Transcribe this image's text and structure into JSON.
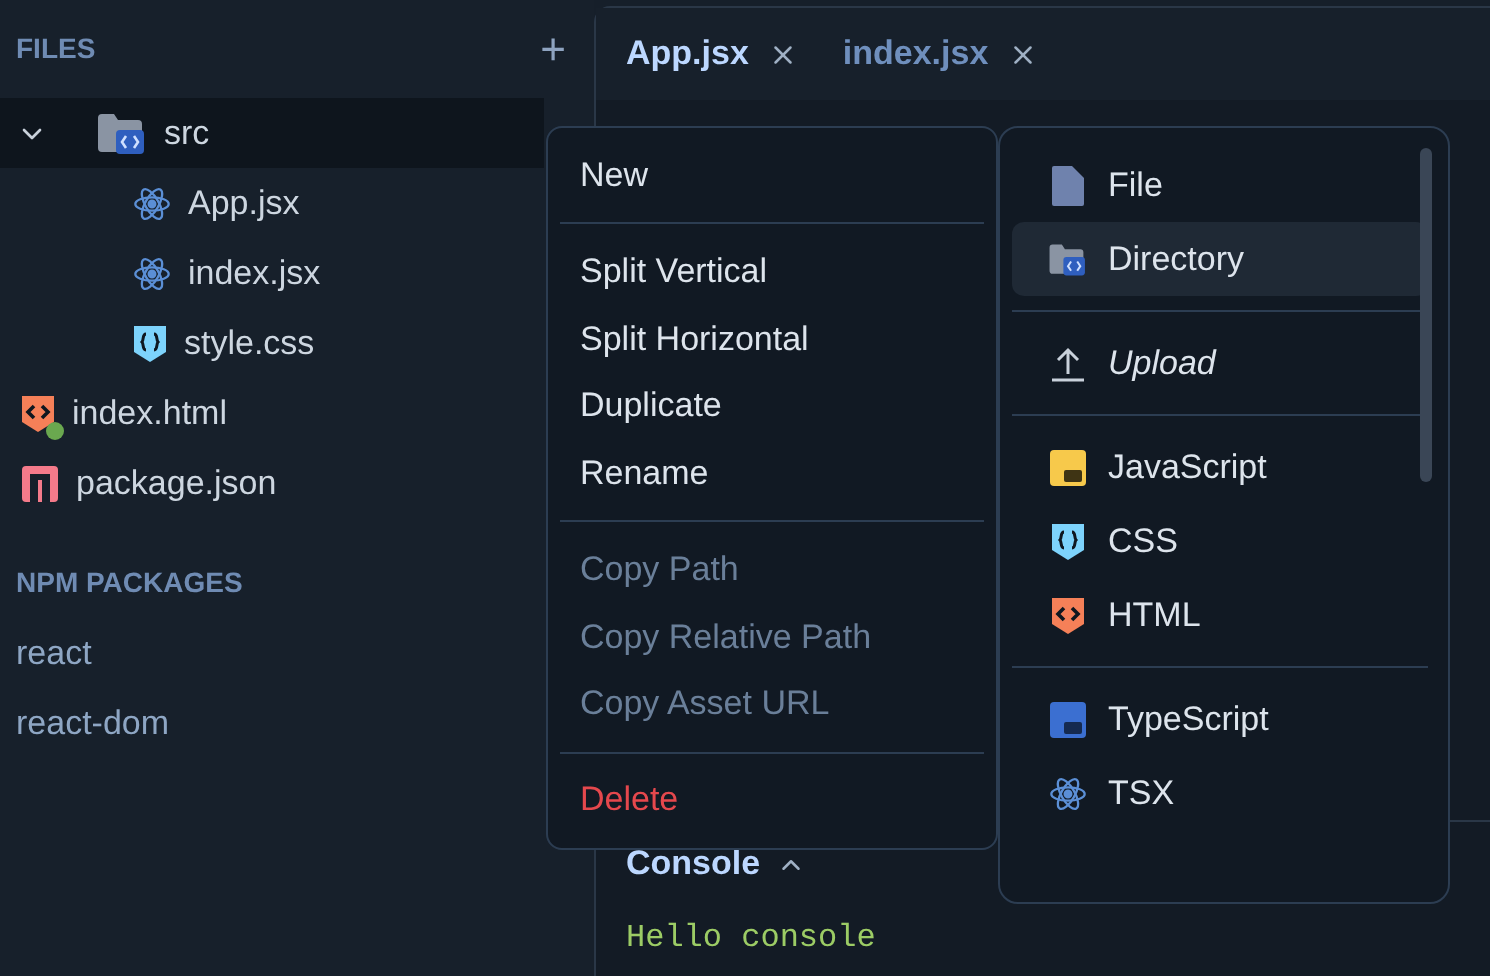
{
  "sidebar": {
    "files_header": "FILES",
    "add_label": "+",
    "tree": [
      {
        "name": "src",
        "kind": "folder",
        "expanded": true,
        "selected": true,
        "modified": false,
        "children": [
          {
            "name": "App.jsx",
            "kind": "jsx",
            "selected": false,
            "modified": false
          },
          {
            "name": "index.jsx",
            "kind": "jsx",
            "selected": false,
            "modified": false
          },
          {
            "name": "style.css",
            "kind": "css",
            "selected": false,
            "modified": false
          }
        ]
      },
      {
        "name": "index.html",
        "kind": "html",
        "selected": false,
        "modified": true
      },
      {
        "name": "package.json",
        "kind": "json",
        "selected": false,
        "modified": false
      }
    ],
    "packages_header": "NPM PACKAGES",
    "packages": [
      "react",
      "react-dom"
    ]
  },
  "tabs": [
    {
      "label": "App.jsx",
      "selected": true
    },
    {
      "label": "index.jsx",
      "selected": false
    }
  ],
  "console": {
    "title": "Console",
    "output": "Hello console"
  },
  "context_menu": [
    {
      "kind": "item",
      "label": "New",
      "disabled": false,
      "danger": false
    },
    {
      "kind": "separator"
    },
    {
      "kind": "item",
      "label": "Split Vertical",
      "disabled": false,
      "danger": false
    },
    {
      "kind": "item",
      "label": "Split Horizontal",
      "disabled": false,
      "danger": false
    },
    {
      "kind": "item",
      "label": "Duplicate",
      "disabled": false,
      "danger": false
    },
    {
      "kind": "item",
      "label": "Rename",
      "disabled": false,
      "danger": false
    },
    {
      "kind": "separator"
    },
    {
      "kind": "item",
      "label": "Copy Path",
      "disabled": true,
      "danger": false
    },
    {
      "kind": "item",
      "label": "Copy Relative Path",
      "disabled": true,
      "danger": false
    },
    {
      "kind": "item",
      "label": "Copy Asset URL",
      "disabled": true,
      "danger": false
    },
    {
      "kind": "separator"
    },
    {
      "kind": "item",
      "label": "Delete",
      "disabled": false,
      "danger": true
    }
  ],
  "submenu": [
    {
      "kind": "file",
      "label": "File",
      "selected": false
    },
    {
      "kind": "folder",
      "label": "Directory",
      "selected": true
    },
    {
      "kind": "separator"
    },
    {
      "kind": "upload",
      "label": "Upload",
      "selected": false
    },
    {
      "kind": "separator"
    },
    {
      "kind": "js",
      "label": "JavaScript",
      "selected": false
    },
    {
      "kind": "css",
      "label": "CSS",
      "selected": false
    },
    {
      "kind": "html",
      "label": "HTML",
      "selected": false
    },
    {
      "kind": "separator"
    },
    {
      "kind": "ts",
      "label": "TypeScript",
      "selected": false
    },
    {
      "kind": "tsx",
      "label": "TSX",
      "selected": false
    }
  ]
}
